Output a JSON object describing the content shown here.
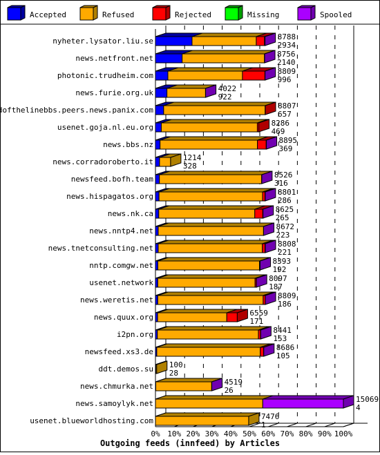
{
  "chart_data": {
    "type": "bar",
    "orientation": "horizontal",
    "stacked": true,
    "title": "Outgoing feeds (innfeed) by Articles",
    "xlim": [
      0,
      100
    ],
    "x_unit": "%",
    "x_ticks": [
      "0%",
      "10%",
      "20%",
      "30%",
      "40%",
      "50%",
      "60%",
      "70%",
      "80%",
      "90%",
      "100%"
    ],
    "grid": true,
    "legend_position": "top",
    "legend": [
      {
        "name": "Accepted",
        "color": "#0000ff",
        "side": "#0000a0"
      },
      {
        "name": "Refused",
        "color": "#ffaa00",
        "side": "#b08000"
      },
      {
        "name": "Rejected",
        "color": "#ff0000",
        "side": "#b00000"
      },
      {
        "name": "Missing",
        "color": "#00ff00",
        "side": "#00a000"
      },
      {
        "name": "Spooled",
        "color": "#aa00ff",
        "side": "#7000b0"
      }
    ],
    "categories": [
      "nyheter.lysator.liu.se",
      "news.netfront.net",
      "photonic.trudheim.com",
      "news.furie.org.uk",
      "endofthelinebbs.peers.news.panix.com",
      "usenet.goja.nl.eu.org",
      "news.bbs.nz",
      "news.corradoroberto.it",
      "newsfeed.bofh.team",
      "news.hispagatos.org",
      "news.nk.ca",
      "news.nntp4.net",
      "news.tnetconsulting.net",
      "nntp.comgw.net",
      "usenet.network",
      "news.weretis.net",
      "news.quux.org",
      "i2pn.org",
      "newsfeed.xs3.de",
      "ddt.demos.su",
      "news.chmurka.net",
      "news.samoylyk.net",
      "usenet.blueworldhosting.com"
    ],
    "offered_labels": [
      "8788",
      "8756",
      "8809",
      "4022",
      "8807",
      "8286",
      "8895",
      "1214",
      "8526",
      "8801",
      "8625",
      "8672",
      "8808",
      "8393",
      "8097",
      "8809",
      "6559",
      "8441",
      "8686",
      "100",
      "4519",
      "15069",
      "7476"
    ],
    "accepted_labels": [
      "2934",
      "2140",
      "996",
      "922",
      "657",
      "469",
      "369",
      "328",
      "316",
      "286",
      "265",
      "223",
      "221",
      "192",
      "187",
      "186",
      "171",
      "153",
      "105",
      "28",
      "26",
      "4",
      "1"
    ],
    "series": [
      {
        "name": "Accepted",
        "values": [
          2934,
          2140,
          996,
          922,
          657,
          469,
          369,
          328,
          316,
          286,
          265,
          223,
          221,
          192,
          187,
          186,
          171,
          153,
          105,
          28,
          26,
          4,
          1
        ]
      },
      {
        "name": "Refused",
        "values": [
          5150,
          6600,
          5980,
          3090,
          8140,
          7700,
          7810,
          886,
          8200,
          8300,
          7700,
          8440,
          8350,
          8150,
          7800,
          8450,
          5550,
          8100,
          8300,
          72,
          4480,
          8600,
          7475
        ]
      },
      {
        "name": "Rejected",
        "values": [
          660,
          0,
          1800,
          0,
          10,
          117,
          700,
          0,
          0,
          200,
          640,
          0,
          220,
          40,
          100,
          170,
          838,
          180,
          270,
          0,
          0,
          0,
          0
        ]
      },
      {
        "name": "Missing",
        "values": [
          0,
          0,
          0,
          0,
          0,
          0,
          0,
          0,
          0,
          0,
          0,
          0,
          0,
          0,
          0,
          0,
          0,
          0,
          0,
          0,
          0,
          0,
          0
        ]
      },
      {
        "name": "Spooled",
        "values": [
          44,
          16,
          13,
          10,
          0,
          0,
          16,
          0,
          10,
          15,
          20,
          9,
          17,
          11,
          10,
          3,
          0,
          8,
          11,
          0,
          13,
          6465,
          0
        ]
      }
    ],
    "max_total": 15069
  }
}
